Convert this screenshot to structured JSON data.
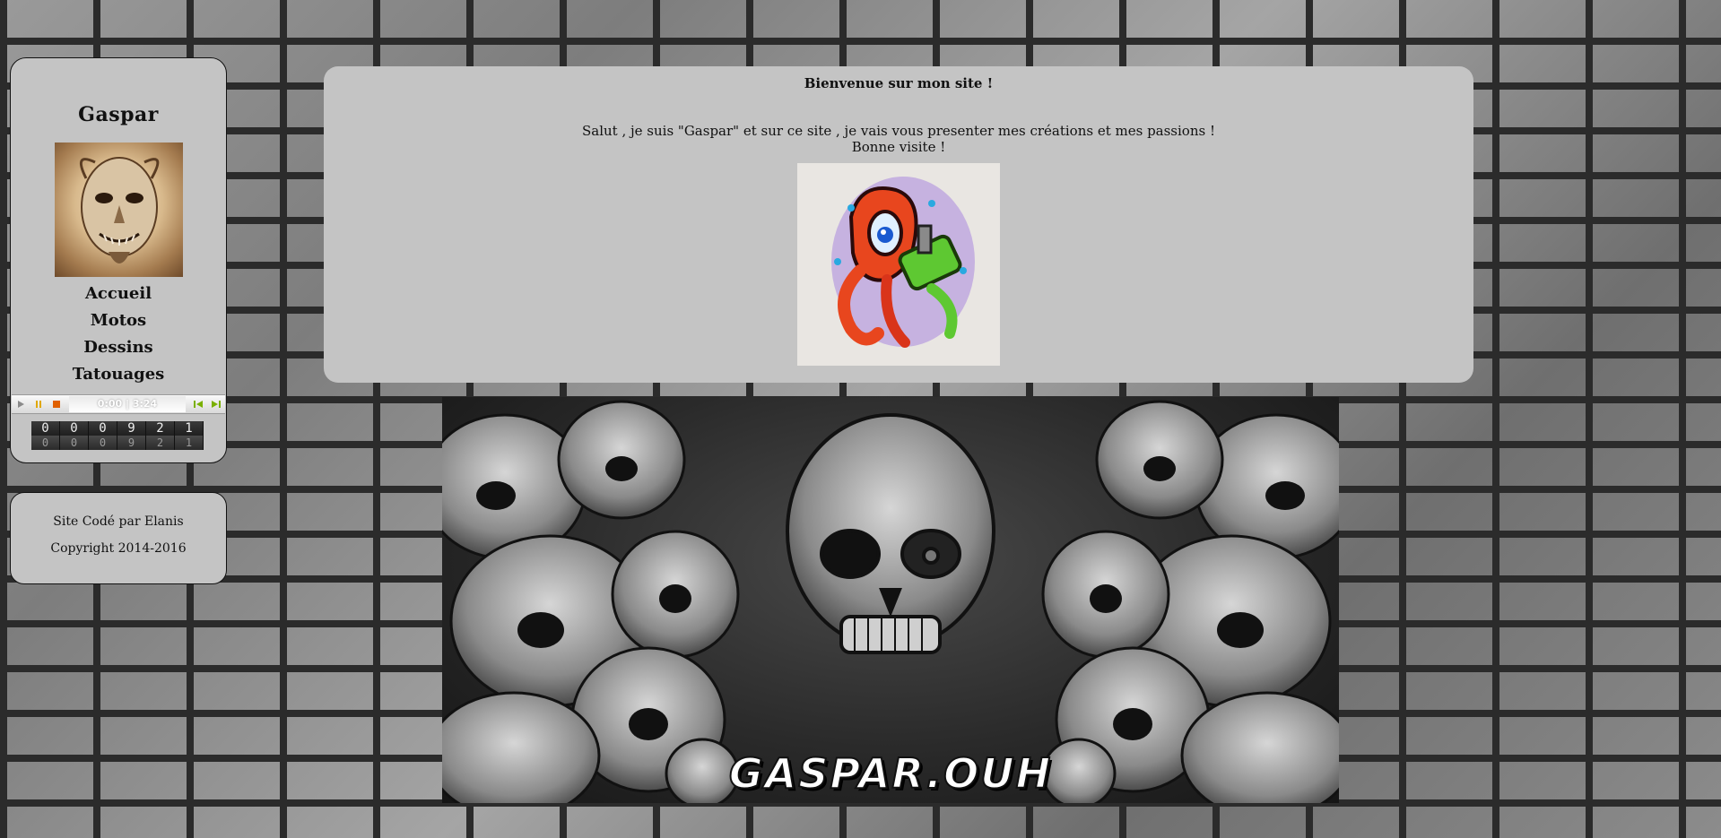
{
  "site": {
    "title": "Gaspar"
  },
  "menu": {
    "items": [
      {
        "label": "Accueil"
      },
      {
        "label": "Motos"
      },
      {
        "label": "Dessins"
      },
      {
        "label": "Tatouages"
      }
    ]
  },
  "player": {
    "time": "0:00 | 3:24",
    "progress_fraction": 0.0
  },
  "counter": {
    "digits": [
      "0",
      "0",
      "0",
      "9",
      "2",
      "1"
    ]
  },
  "credits": {
    "line1": "Site Codé par Elanis",
    "line2": "Copyright 2014-2016"
  },
  "welcome": {
    "heading": "Bienvenue sur mon site !",
    "intro_line1": "Salut , je suis \"Gaspar\" et sur ce site , je vais vous presenter mes créations et mes passions !",
    "intro_line2": "Bonne visite !"
  },
  "banner": {
    "logo_text": "GASPAR.OUH"
  },
  "colors": {
    "panel_bg": "#c4c4c4",
    "wall_dark": "#2b2b2b",
    "wall_light": "#9a9a9a"
  }
}
